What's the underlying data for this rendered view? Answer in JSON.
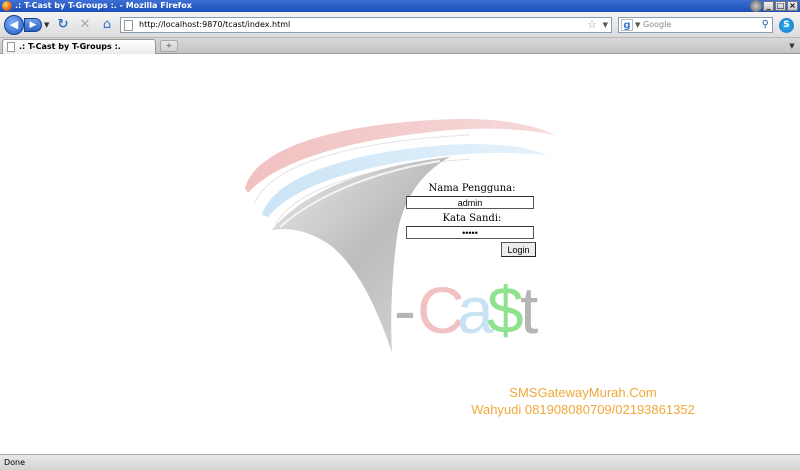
{
  "window": {
    "title": ".: T-Cast by T-Groups :. - Mozilla Firefox",
    "controls": [
      "_",
      "□",
      "×"
    ]
  },
  "navbar": {
    "url": "http://localhost:9870/tcast/index.html",
    "search_placeholder": "Google",
    "icons": [
      "back-icon",
      "forward-icon",
      "reload-icon",
      "stop-icon",
      "home-icon",
      "bookmark-star-icon",
      "search-icon",
      "skype-icon"
    ]
  },
  "tabs": [
    {
      "label": ".: T-Cast by T-Groups :."
    }
  ],
  "logo": {
    "prefix": "-",
    "c": "C",
    "a": "a",
    "dollar": "$",
    "t": "t",
    "colors": {
      "prefix": "#b5b5b5",
      "c": "#f2c2c2",
      "a": "#c9e3f5",
      "dollar": "#8fe28f",
      "t": "#b5b5b5",
      "swoosh_red": "#f0c6c6",
      "swoosh_blue": "#cfe6f6"
    }
  },
  "login": {
    "username_label": "Nama Pengguna:",
    "username_value": "admin",
    "password_label": "Kata Sandi:",
    "password_value": "•••••",
    "submit_label": "Login"
  },
  "promo": {
    "line1": "SMSGatewayMurah.Com",
    "line2": "Wahyudi 081908080709/02193861352",
    "color": "#f0a83a"
  },
  "status": {
    "text": "Done"
  }
}
